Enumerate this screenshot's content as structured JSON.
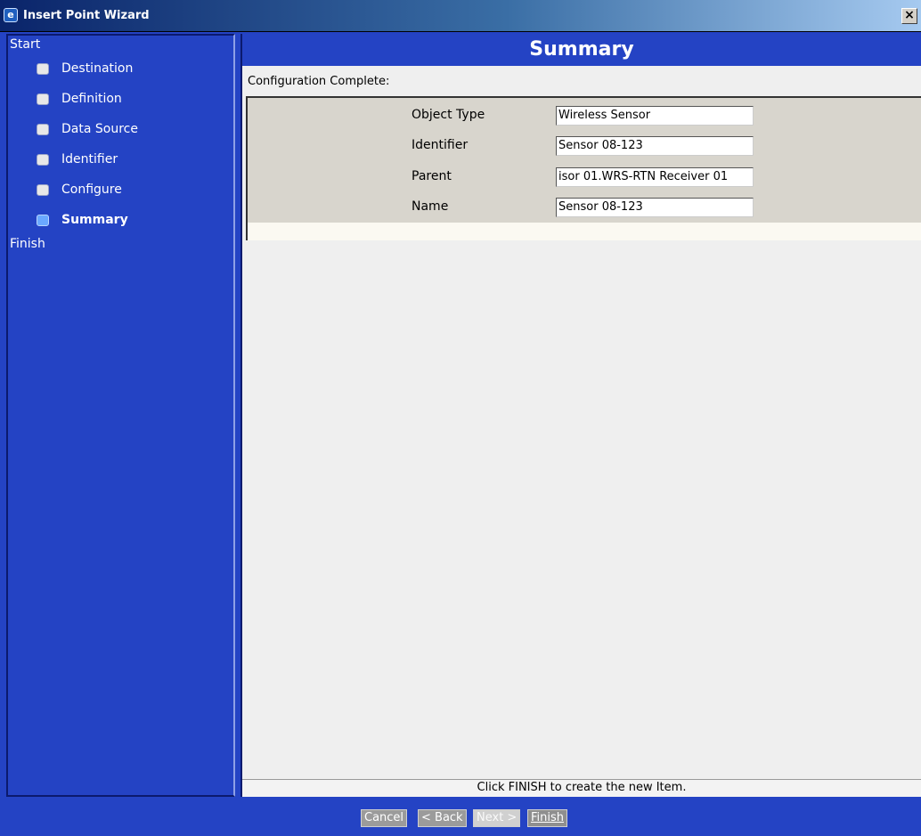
{
  "window": {
    "title": "Insert Point Wizard",
    "close_glyph": "×",
    "app_icon": "wizard-app-icon"
  },
  "sidebar": {
    "start_label": "Start",
    "finish_label": "Finish",
    "items": [
      {
        "label": "Destination",
        "current": false
      },
      {
        "label": "Definition",
        "current": false
      },
      {
        "label": "Data Source",
        "current": false
      },
      {
        "label": "Identifier",
        "current": false
      },
      {
        "label": "Configure",
        "current": false
      },
      {
        "label": "Summary",
        "current": true
      }
    ]
  },
  "main": {
    "header": "Summary",
    "config_label": "Configuration Complete:",
    "fields": [
      {
        "label": "Object Type",
        "value": "Wireless Sensor"
      },
      {
        "label": "Identifier",
        "value": "Sensor 08-123"
      },
      {
        "label": "Parent",
        "value": "isor 01.WRS-RTN Receiver 01"
      },
      {
        "label": "Name",
        "value": "Sensor 08-123"
      }
    ],
    "footer_message": "Click FINISH to create the new Item."
  },
  "buttons": {
    "cancel": "Cancel",
    "back": "< Back",
    "next": "Next >",
    "finish": "Finish"
  },
  "colors": {
    "panel_blue": "#2443c4",
    "field_bg": "#d8d5cd"
  }
}
